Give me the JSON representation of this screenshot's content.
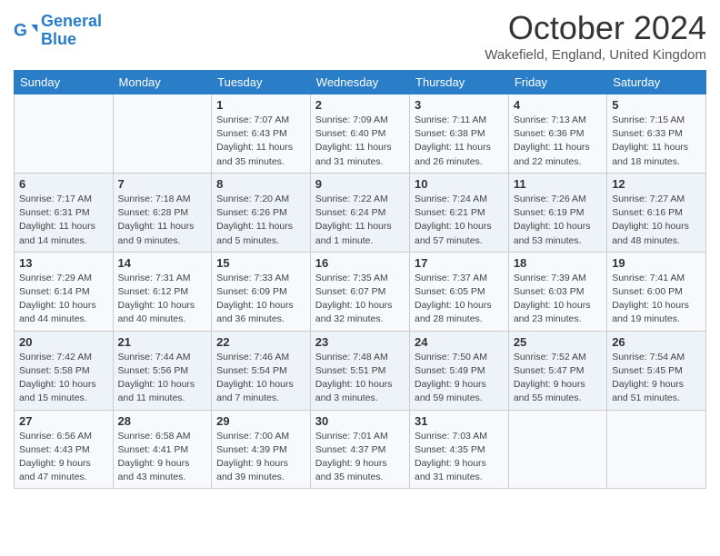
{
  "header": {
    "logo_line1": "General",
    "logo_line2": "Blue",
    "month_title": "October 2024",
    "subtitle": "Wakefield, England, United Kingdom"
  },
  "weekdays": [
    "Sunday",
    "Monday",
    "Tuesday",
    "Wednesday",
    "Thursday",
    "Friday",
    "Saturday"
  ],
  "weeks": [
    [
      {
        "day": "",
        "sunrise": "",
        "sunset": "",
        "daylight": ""
      },
      {
        "day": "",
        "sunrise": "",
        "sunset": "",
        "daylight": ""
      },
      {
        "day": "1",
        "sunrise": "Sunrise: 7:07 AM",
        "sunset": "Sunset: 6:43 PM",
        "daylight": "Daylight: 11 hours and 35 minutes."
      },
      {
        "day": "2",
        "sunrise": "Sunrise: 7:09 AM",
        "sunset": "Sunset: 6:40 PM",
        "daylight": "Daylight: 11 hours and 31 minutes."
      },
      {
        "day": "3",
        "sunrise": "Sunrise: 7:11 AM",
        "sunset": "Sunset: 6:38 PM",
        "daylight": "Daylight: 11 hours and 26 minutes."
      },
      {
        "day": "4",
        "sunrise": "Sunrise: 7:13 AM",
        "sunset": "Sunset: 6:36 PM",
        "daylight": "Daylight: 11 hours and 22 minutes."
      },
      {
        "day": "5",
        "sunrise": "Sunrise: 7:15 AM",
        "sunset": "Sunset: 6:33 PM",
        "daylight": "Daylight: 11 hours and 18 minutes."
      }
    ],
    [
      {
        "day": "6",
        "sunrise": "Sunrise: 7:17 AM",
        "sunset": "Sunset: 6:31 PM",
        "daylight": "Daylight: 11 hours and 14 minutes."
      },
      {
        "day": "7",
        "sunrise": "Sunrise: 7:18 AM",
        "sunset": "Sunset: 6:28 PM",
        "daylight": "Daylight: 11 hours and 9 minutes."
      },
      {
        "day": "8",
        "sunrise": "Sunrise: 7:20 AM",
        "sunset": "Sunset: 6:26 PM",
        "daylight": "Daylight: 11 hours and 5 minutes."
      },
      {
        "day": "9",
        "sunrise": "Sunrise: 7:22 AM",
        "sunset": "Sunset: 6:24 PM",
        "daylight": "Daylight: 11 hours and 1 minute."
      },
      {
        "day": "10",
        "sunrise": "Sunrise: 7:24 AM",
        "sunset": "Sunset: 6:21 PM",
        "daylight": "Daylight: 10 hours and 57 minutes."
      },
      {
        "day": "11",
        "sunrise": "Sunrise: 7:26 AM",
        "sunset": "Sunset: 6:19 PM",
        "daylight": "Daylight: 10 hours and 53 minutes."
      },
      {
        "day": "12",
        "sunrise": "Sunrise: 7:27 AM",
        "sunset": "Sunset: 6:16 PM",
        "daylight": "Daylight: 10 hours and 48 minutes."
      }
    ],
    [
      {
        "day": "13",
        "sunrise": "Sunrise: 7:29 AM",
        "sunset": "Sunset: 6:14 PM",
        "daylight": "Daylight: 10 hours and 44 minutes."
      },
      {
        "day": "14",
        "sunrise": "Sunrise: 7:31 AM",
        "sunset": "Sunset: 6:12 PM",
        "daylight": "Daylight: 10 hours and 40 minutes."
      },
      {
        "day": "15",
        "sunrise": "Sunrise: 7:33 AM",
        "sunset": "Sunset: 6:09 PM",
        "daylight": "Daylight: 10 hours and 36 minutes."
      },
      {
        "day": "16",
        "sunrise": "Sunrise: 7:35 AM",
        "sunset": "Sunset: 6:07 PM",
        "daylight": "Daylight: 10 hours and 32 minutes."
      },
      {
        "day": "17",
        "sunrise": "Sunrise: 7:37 AM",
        "sunset": "Sunset: 6:05 PM",
        "daylight": "Daylight: 10 hours and 28 minutes."
      },
      {
        "day": "18",
        "sunrise": "Sunrise: 7:39 AM",
        "sunset": "Sunset: 6:03 PM",
        "daylight": "Daylight: 10 hours and 23 minutes."
      },
      {
        "day": "19",
        "sunrise": "Sunrise: 7:41 AM",
        "sunset": "Sunset: 6:00 PM",
        "daylight": "Daylight: 10 hours and 19 minutes."
      }
    ],
    [
      {
        "day": "20",
        "sunrise": "Sunrise: 7:42 AM",
        "sunset": "Sunset: 5:58 PM",
        "daylight": "Daylight: 10 hours and 15 minutes."
      },
      {
        "day": "21",
        "sunrise": "Sunrise: 7:44 AM",
        "sunset": "Sunset: 5:56 PM",
        "daylight": "Daylight: 10 hours and 11 minutes."
      },
      {
        "day": "22",
        "sunrise": "Sunrise: 7:46 AM",
        "sunset": "Sunset: 5:54 PM",
        "daylight": "Daylight: 10 hours and 7 minutes."
      },
      {
        "day": "23",
        "sunrise": "Sunrise: 7:48 AM",
        "sunset": "Sunset: 5:51 PM",
        "daylight": "Daylight: 10 hours and 3 minutes."
      },
      {
        "day": "24",
        "sunrise": "Sunrise: 7:50 AM",
        "sunset": "Sunset: 5:49 PM",
        "daylight": "Daylight: 9 hours and 59 minutes."
      },
      {
        "day": "25",
        "sunrise": "Sunrise: 7:52 AM",
        "sunset": "Sunset: 5:47 PM",
        "daylight": "Daylight: 9 hours and 55 minutes."
      },
      {
        "day": "26",
        "sunrise": "Sunrise: 7:54 AM",
        "sunset": "Sunset: 5:45 PM",
        "daylight": "Daylight: 9 hours and 51 minutes."
      }
    ],
    [
      {
        "day": "27",
        "sunrise": "Sunrise: 6:56 AM",
        "sunset": "Sunset: 4:43 PM",
        "daylight": "Daylight: 9 hours and 47 minutes."
      },
      {
        "day": "28",
        "sunrise": "Sunrise: 6:58 AM",
        "sunset": "Sunset: 4:41 PM",
        "daylight": "Daylight: 9 hours and 43 minutes."
      },
      {
        "day": "29",
        "sunrise": "Sunrise: 7:00 AM",
        "sunset": "Sunset: 4:39 PM",
        "daylight": "Daylight: 9 hours and 39 minutes."
      },
      {
        "day": "30",
        "sunrise": "Sunrise: 7:01 AM",
        "sunset": "Sunset: 4:37 PM",
        "daylight": "Daylight: 9 hours and 35 minutes."
      },
      {
        "day": "31",
        "sunrise": "Sunrise: 7:03 AM",
        "sunset": "Sunset: 4:35 PM",
        "daylight": "Daylight: 9 hours and 31 minutes."
      },
      {
        "day": "",
        "sunrise": "",
        "sunset": "",
        "daylight": ""
      },
      {
        "day": "",
        "sunrise": "",
        "sunset": "",
        "daylight": ""
      }
    ]
  ]
}
